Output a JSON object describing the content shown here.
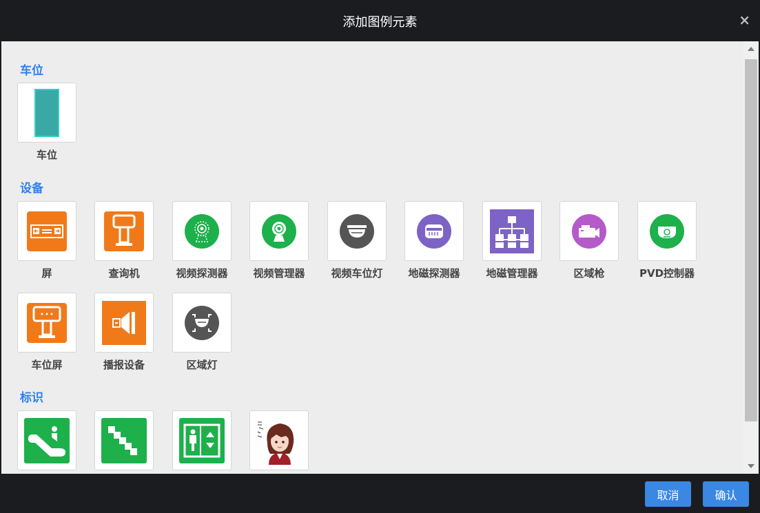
{
  "dialog": {
    "title": "添加图例元素",
    "close_label": "×"
  },
  "sections": {
    "parking": {
      "title": "车位",
      "items": [
        {
          "label": "车位",
          "icon": "parking-space-icon"
        }
      ]
    },
    "devices": {
      "title": "设备",
      "items": [
        {
          "label": "屏",
          "icon": "screen-icon"
        },
        {
          "label": "查询机",
          "icon": "kiosk-icon"
        },
        {
          "label": "视频探测器",
          "icon": "video-detector-icon"
        },
        {
          "label": "视频管理器",
          "icon": "video-manager-icon"
        },
        {
          "label": "视频车位灯",
          "icon": "dome-light-icon"
        },
        {
          "label": "地磁探测器",
          "icon": "magnetic-detector-icon"
        },
        {
          "label": "地磁管理器",
          "icon": "network-topology-icon"
        },
        {
          "label": "区域枪",
          "icon": "camera-gun-icon"
        },
        {
          "label": "PVD控制器",
          "icon": "pvd-controller-icon"
        },
        {
          "label": "车位屏",
          "icon": "space-screen-icon"
        },
        {
          "label": "播报设备",
          "icon": "speaker-icon"
        },
        {
          "label": "区域灯",
          "icon": "area-light-icon"
        }
      ]
    },
    "signs": {
      "title": "标识",
      "items": [
        {
          "icon": "escalator-icon"
        },
        {
          "icon": "stairs-icon"
        },
        {
          "icon": "elevator-icon"
        },
        {
          "icon": "anime-avatar-icon"
        }
      ]
    }
  },
  "footer": {
    "cancel_label": "取消",
    "confirm_label": "确认"
  },
  "colors": {
    "accent": "#3a87e4",
    "section_title": "#2f80ed",
    "orange": "#f07a1a",
    "green": "#1db04b",
    "dark_gray": "#555555",
    "purple": "#7d63c6",
    "magenta": "#b55ac9",
    "teal": "#3aa8a4"
  }
}
